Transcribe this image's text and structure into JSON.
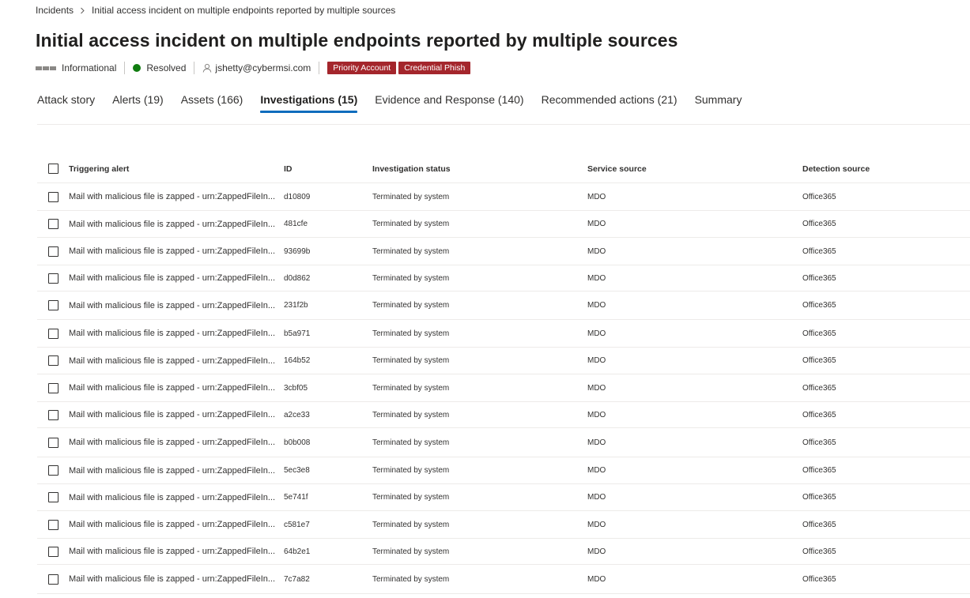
{
  "breadcrumb": {
    "root": "Incidents",
    "current": "Initial access incident on multiple endpoints reported by multiple sources"
  },
  "title": "Initial access incident on multiple endpoints reported by multiple sources",
  "meta": {
    "severity": "Informational",
    "status": "Resolved",
    "assigned_to": "jshetty@cybermsi.com",
    "tags": [
      "Priority Account",
      "Credential Phish"
    ]
  },
  "colors": {
    "tag_background": "#a4262c",
    "status_resolved": "#107c10",
    "active_tab_underline": "#0f6cbd"
  },
  "tabs": [
    {
      "label": "Attack story",
      "active": false
    },
    {
      "label": "Alerts (19)",
      "active": false
    },
    {
      "label": "Assets (166)",
      "active": false
    },
    {
      "label": "Investigations (15)",
      "active": true
    },
    {
      "label": "Evidence and Response (140)",
      "active": false
    },
    {
      "label": "Recommended actions (21)",
      "active": false
    },
    {
      "label": "Summary",
      "active": false
    }
  ],
  "table": {
    "columns": [
      "Triggering alert",
      "ID",
      "Investigation status",
      "Service source",
      "Detection source"
    ],
    "rows": [
      {
        "alert": "Mail with malicious file is zapped - urn:ZappedFileIn...",
        "id": "d10809",
        "status": "Terminated by system",
        "service": "MDO",
        "detection": "Office365"
      },
      {
        "alert": "Mail with malicious file is zapped - urn:ZappedFileIn...",
        "id": "481cfe",
        "status": "Terminated by system",
        "service": "MDO",
        "detection": "Office365"
      },
      {
        "alert": "Mail with malicious file is zapped - urn:ZappedFileIn...",
        "id": "93699b",
        "status": "Terminated by system",
        "service": "MDO",
        "detection": "Office365"
      },
      {
        "alert": "Mail with malicious file is zapped - urn:ZappedFileIn...",
        "id": "d0d862",
        "status": "Terminated by system",
        "service": "MDO",
        "detection": "Office365"
      },
      {
        "alert": "Mail with malicious file is zapped - urn:ZappedFileIn...",
        "id": "231f2b",
        "status": "Terminated by system",
        "service": "MDO",
        "detection": "Office365"
      },
      {
        "alert": "Mail with malicious file is zapped - urn:ZappedFileIn...",
        "id": "b5a971",
        "status": "Terminated by system",
        "service": "MDO",
        "detection": "Office365"
      },
      {
        "alert": "Mail with malicious file is zapped - urn:ZappedFileIn...",
        "id": "164b52",
        "status": "Terminated by system",
        "service": "MDO",
        "detection": "Office365"
      },
      {
        "alert": "Mail with malicious file is zapped - urn:ZappedFileIn...",
        "id": "3cbf05",
        "status": "Terminated by system",
        "service": "MDO",
        "detection": "Office365"
      },
      {
        "alert": "Mail with malicious file is zapped - urn:ZappedFileIn...",
        "id": "a2ce33",
        "status": "Terminated by system",
        "service": "MDO",
        "detection": "Office365"
      },
      {
        "alert": "Mail with malicious file is zapped - urn:ZappedFileIn...",
        "id": "b0b008",
        "status": "Terminated by system",
        "service": "MDO",
        "detection": "Office365"
      },
      {
        "alert": "Mail with malicious file is zapped - urn:ZappedFileIn...",
        "id": "5ec3e8",
        "status": "Terminated by system",
        "service": "MDO",
        "detection": "Office365"
      },
      {
        "alert": "Mail with malicious file is zapped - urn:ZappedFileIn...",
        "id": "5e741f",
        "status": "Terminated by system",
        "service": "MDO",
        "detection": "Office365"
      },
      {
        "alert": "Mail with malicious file is zapped - urn:ZappedFileIn...",
        "id": "c581e7",
        "status": "Terminated by system",
        "service": "MDO",
        "detection": "Office365"
      },
      {
        "alert": "Mail with malicious file is zapped - urn:ZappedFileIn...",
        "id": "64b2e1",
        "status": "Terminated by system",
        "service": "MDO",
        "detection": "Office365"
      },
      {
        "alert": "Mail with malicious file is zapped - urn:ZappedFileIn...",
        "id": "7c7a82",
        "status": "Terminated by system",
        "service": "MDO",
        "detection": "Office365"
      }
    ]
  }
}
